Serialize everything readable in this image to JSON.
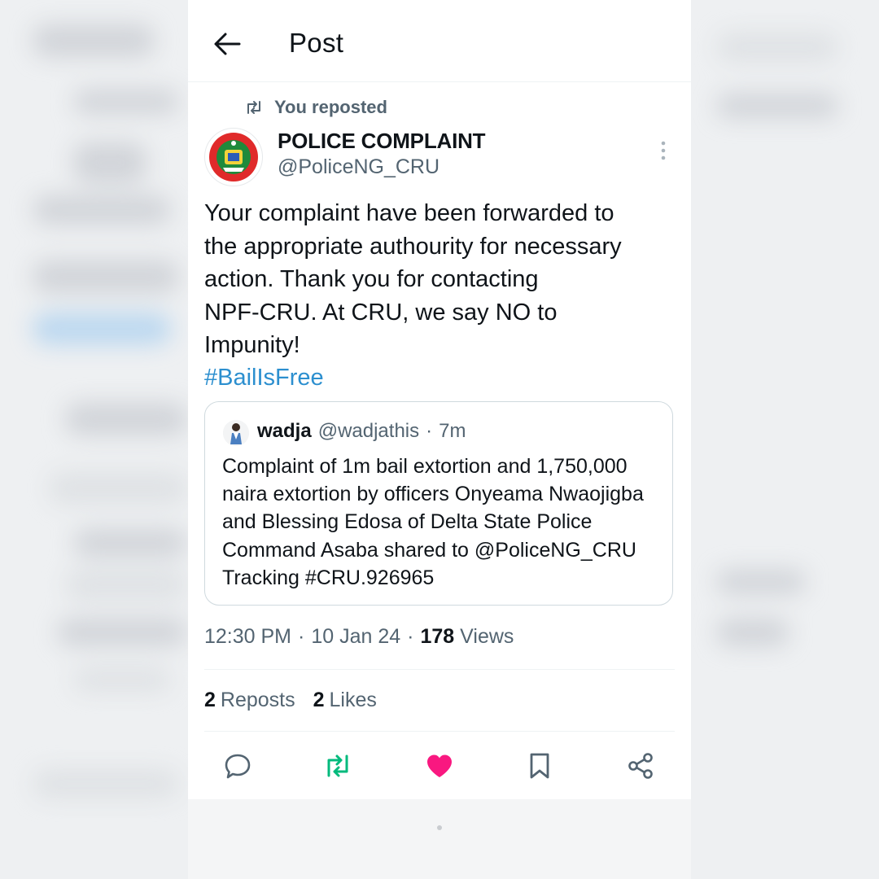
{
  "header": {
    "title": "Post"
  },
  "repost_context": {
    "label": "You reposted"
  },
  "author": {
    "name": "POLICE COMPLAINT",
    "handle": "@PoliceNG_CRU"
  },
  "post": {
    "text": "Your complaint have been forwarded to\nthe appropriate authourity for necessary\naction. Thank you for contacting\nNPF-CRU. At CRU, we say NO to\nImpunity!",
    "hashtag": "#BailIsFree"
  },
  "quoted_post": {
    "name": "wadja",
    "handle": "@wadjathis",
    "separator": "·",
    "time": "7m",
    "text": "Complaint of 1m bail extortion and 1,750,000 naira extortion by officers Onyeama Nwaojigba and Blessing Edosa of Delta State Police Command Asaba shared to @PoliceNG_CRU Tracking #CRU.926965"
  },
  "meta": {
    "time": "12:30 PM",
    "separator": "·",
    "date": "10 Jan 24",
    "views_count": "178",
    "views_label": "Views"
  },
  "stats": {
    "reposts_count": "2",
    "reposts_label": "Reposts",
    "likes_count": "2",
    "likes_label": "Likes"
  },
  "colors": {
    "text": "#0f1419",
    "secondary": "#536471",
    "link": "#2c8fcf",
    "repost_active": "#00ba7c",
    "like_active": "#f91880"
  },
  "icons": {
    "back": "arrow-left-icon",
    "repost": "repost-icon",
    "more": "more-vertical-icon",
    "reply": "reply-icon",
    "like": "heart-icon",
    "bookmark": "bookmark-icon",
    "share": "share-icon"
  }
}
